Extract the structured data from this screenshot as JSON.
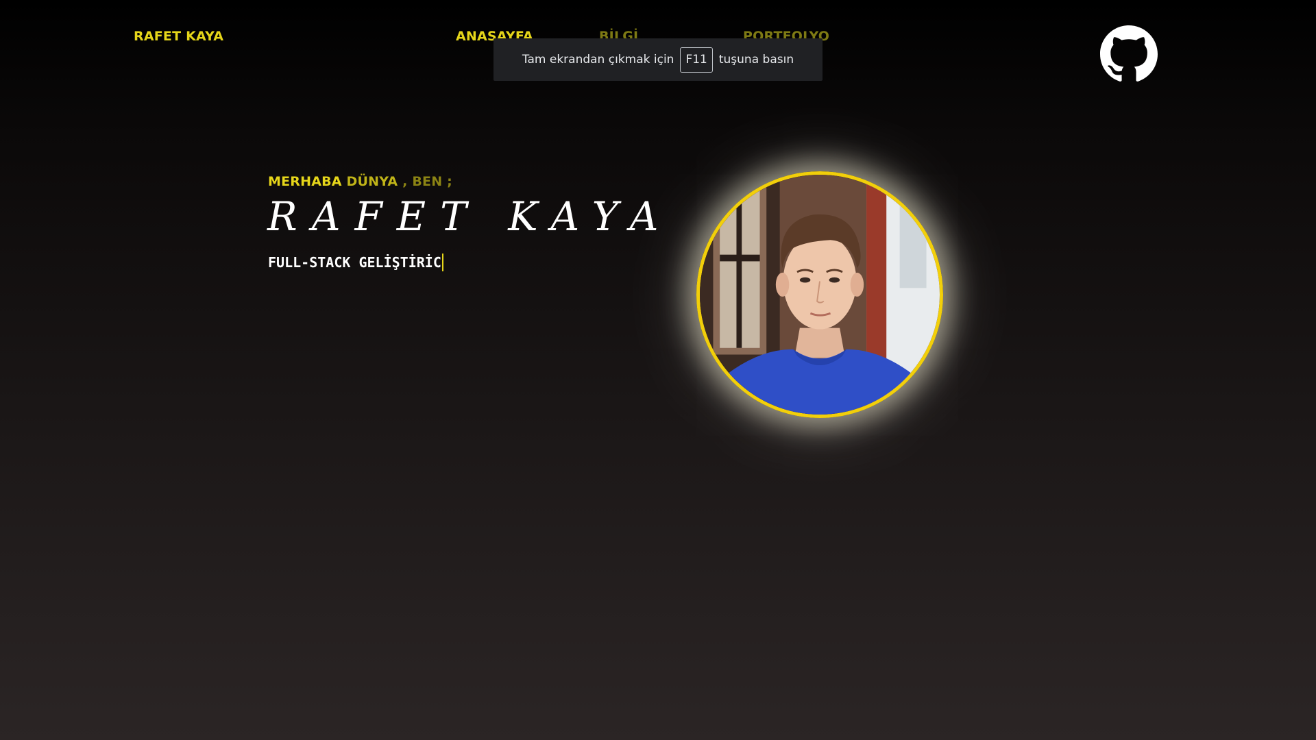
{
  "nav": {
    "brand": "RAFET KAYA",
    "items": [
      {
        "label": "ANASAYFA",
        "active": true
      },
      {
        "label": "BİLGİ",
        "active": false
      },
      {
        "label": "PORTFOLYO",
        "active": false
      }
    ],
    "github_icon": "github-icon"
  },
  "fullscreen_toast": {
    "before": "Tam ekrandan çıkmak için",
    "key": "F11",
    "after": "tuşuna basın"
  },
  "hero": {
    "greeting_1": "MERHABA",
    "greeting_2": "DÜNYA",
    "greeting_3": ", BEN ;",
    "name": "RAFET KAYA",
    "role": "FULL-STACK GELİŞTİRİC"
  },
  "colors": {
    "accent": "#e6d61a",
    "accent_dim": "#7e7a14",
    "avatar_border": "#f2cf0a",
    "background_top": "#000000",
    "background_bottom": "#2b2525"
  }
}
